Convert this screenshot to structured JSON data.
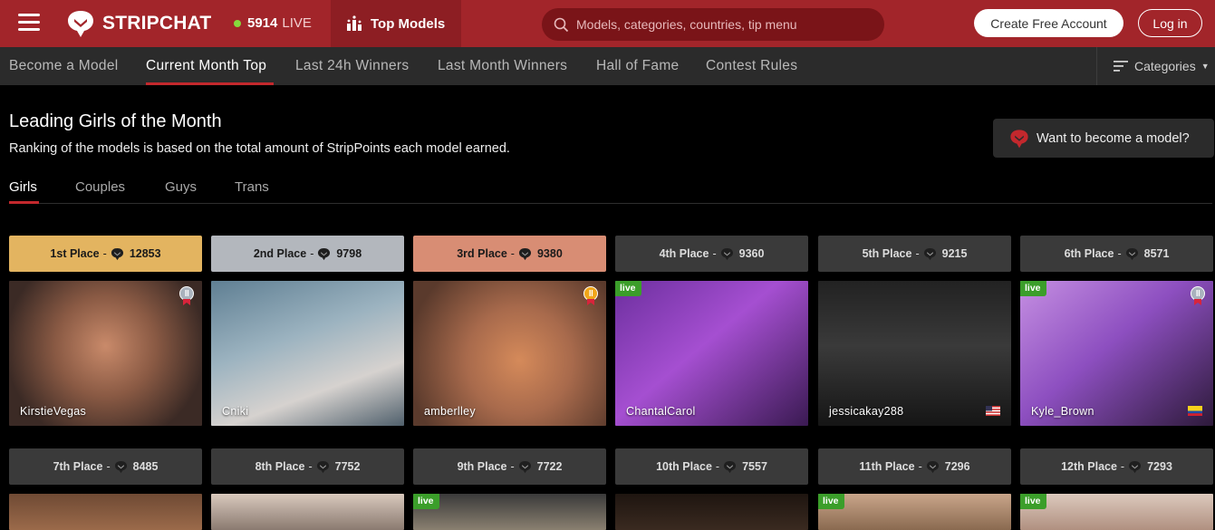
{
  "header": {
    "logo_text": "STRIPCHAT",
    "live_count": "5914",
    "live_label": "LIVE",
    "top_models_label": "Top Models",
    "search_placeholder": "Models, categories, countries, tip menu",
    "create_account_label": "Create Free Account",
    "login_label": "Log in",
    "accent_color": "#a2252a"
  },
  "subnav": {
    "items": [
      "Become a Model",
      "Current Month Top",
      "Last 24h Winners",
      "Last Month Winners",
      "Hall of Fame",
      "Contest Rules"
    ],
    "active": "Current Month Top",
    "categories_label": "Categories"
  },
  "page": {
    "title": "Leading Girls of the Month",
    "subtitle": "Ranking of the models is based on the total amount of StripPoints each model earned.",
    "want_model_label": "Want to become a model?"
  },
  "tabs": {
    "items": [
      "Girls",
      "Couples",
      "Guys",
      "Trans"
    ],
    "active": "Girls"
  },
  "rankings": [
    {
      "place": "1st Place",
      "points": "12853",
      "name": "KirstieVegas",
      "live": false,
      "badge": "silver-badge",
      "flag": ""
    },
    {
      "place": "2nd Place",
      "points": "9798",
      "name": "Cniki",
      "live": false,
      "badge": "",
      "flag": ""
    },
    {
      "place": "3rd Place",
      "points": "9380",
      "name": "amberlley",
      "live": false,
      "badge": "gold-badge",
      "flag": ""
    },
    {
      "place": "4th Place",
      "points": "9360",
      "name": "ChantalCarol",
      "live": true,
      "badge": "",
      "flag": ""
    },
    {
      "place": "5th Place",
      "points": "9215",
      "name": "jessicakay288",
      "live": false,
      "badge": "",
      "flag": "us-flag"
    },
    {
      "place": "6th Place",
      "points": "8571",
      "name": "Kyle_Brown",
      "live": true,
      "badge": "silver-badge",
      "flag": "co-flag"
    },
    {
      "place": "7th Place",
      "points": "8485",
      "name": "",
      "live": false
    },
    {
      "place": "8th Place",
      "points": "7752",
      "name": "",
      "live": false
    },
    {
      "place": "9th Place",
      "points": "7722",
      "name": "",
      "live": true
    },
    {
      "place": "10th Place",
      "points": "7557",
      "name": "",
      "live": false
    },
    {
      "place": "11th Place",
      "points": "7296",
      "name": "",
      "live": true
    },
    {
      "place": "12th Place",
      "points": "7293",
      "name": "",
      "live": true
    }
  ],
  "live_badge_label": "live",
  "place_separator": "-"
}
